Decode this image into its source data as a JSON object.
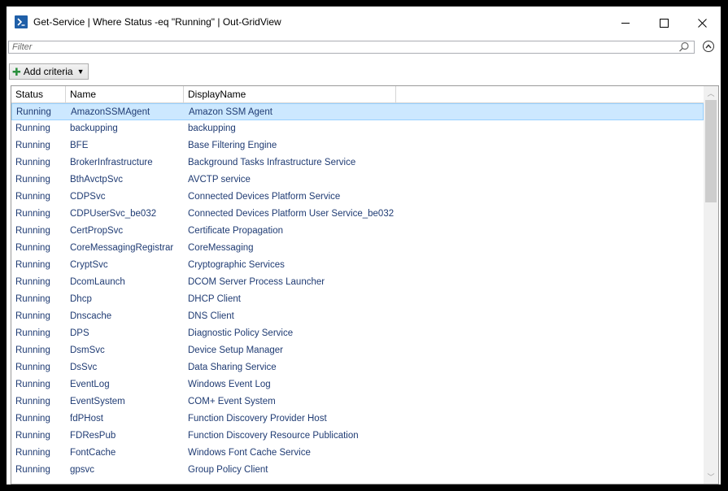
{
  "window": {
    "title": "Get-Service | Where Status -eq \"Running\" | Out-GridView",
    "minimize": "–",
    "maximize": "☐",
    "close": "✕"
  },
  "filter": {
    "placeholder": "Filter",
    "value": ""
  },
  "criteria": {
    "label": "Add criteria"
  },
  "grid": {
    "columns": [
      "Status",
      "Name",
      "DisplayName"
    ],
    "selected_index": 0,
    "rows": [
      [
        "Running",
        "AmazonSSMAgent",
        "Amazon SSM Agent"
      ],
      [
        "Running",
        "backupping",
        "backupping"
      ],
      [
        "Running",
        "BFE",
        "Base Filtering Engine"
      ],
      [
        "Running",
        "BrokerInfrastructure",
        "Background Tasks Infrastructure Service"
      ],
      [
        "Running",
        "BthAvctpSvc",
        "AVCTP service"
      ],
      [
        "Running",
        "CDPSvc",
        "Connected Devices Platform Service"
      ],
      [
        "Running",
        "CDPUserSvc_be032",
        "Connected Devices Platform User Service_be032"
      ],
      [
        "Running",
        "CertPropSvc",
        "Certificate Propagation"
      ],
      [
        "Running",
        "CoreMessagingRegistrar",
        "CoreMessaging"
      ],
      [
        "Running",
        "CryptSvc",
        "Cryptographic Services"
      ],
      [
        "Running",
        "DcomLaunch",
        "DCOM Server Process Launcher"
      ],
      [
        "Running",
        "Dhcp",
        "DHCP Client"
      ],
      [
        "Running",
        "Dnscache",
        "DNS Client"
      ],
      [
        "Running",
        "DPS",
        "Diagnostic Policy Service"
      ],
      [
        "Running",
        "DsmSvc",
        "Device Setup Manager"
      ],
      [
        "Running",
        "DsSvc",
        "Data Sharing Service"
      ],
      [
        "Running",
        "EventLog",
        "Windows Event Log"
      ],
      [
        "Running",
        "EventSystem",
        "COM+ Event System"
      ],
      [
        "Running",
        "fdPHost",
        "Function Discovery Provider Host"
      ],
      [
        "Running",
        "FDResPub",
        "Function Discovery Resource Publication"
      ],
      [
        "Running",
        "FontCache",
        "Windows Font Cache Service"
      ],
      [
        "Running",
        "gpsvc",
        "Group Policy Client"
      ]
    ]
  },
  "colors": {
    "row_text": "#1f3b73",
    "selection_bg": "#cce8ff",
    "selection_border": "#99d1ff",
    "add_icon": "#2a8f3c",
    "ps_icon": "#1f5fa8"
  },
  "icons": {
    "app": "powershell-icon",
    "search": "search-icon",
    "collapse": "chevron-up-circle-icon",
    "add": "plus-icon",
    "dropdown": "triangle-down-icon"
  }
}
